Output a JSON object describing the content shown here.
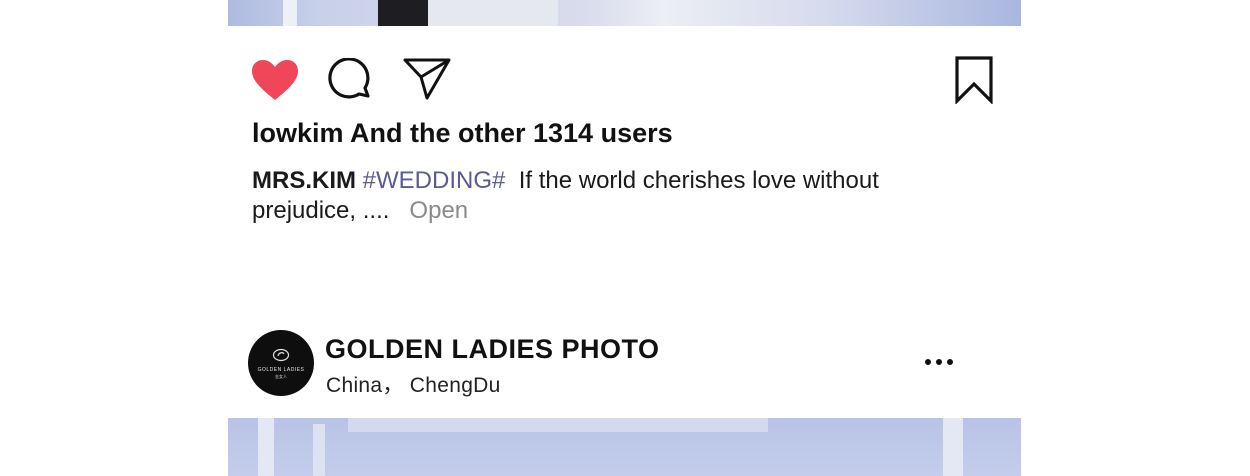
{
  "post": {
    "likes_text": "lowkim And the other 1314 users",
    "caption": {
      "username": "MRS.KIM",
      "hashtag": "#WEDDING#",
      "text": "If the world cherishes love without prejudice, ....",
      "open_label": "Open"
    },
    "actions": {
      "like_icon": "heart-filled-icon",
      "comment_icon": "comment-icon",
      "share_icon": "send-icon",
      "save_icon": "bookmark-icon",
      "like_color": "#f0465a"
    }
  },
  "next_post": {
    "account_name": "GOLDEN LADIES PHOTO",
    "location": "China， ChengDu",
    "avatar_logo_text": "GOLDEN LADIES",
    "avatar_logo_sub": "金女人",
    "more_icon": "more-dots-icon"
  }
}
